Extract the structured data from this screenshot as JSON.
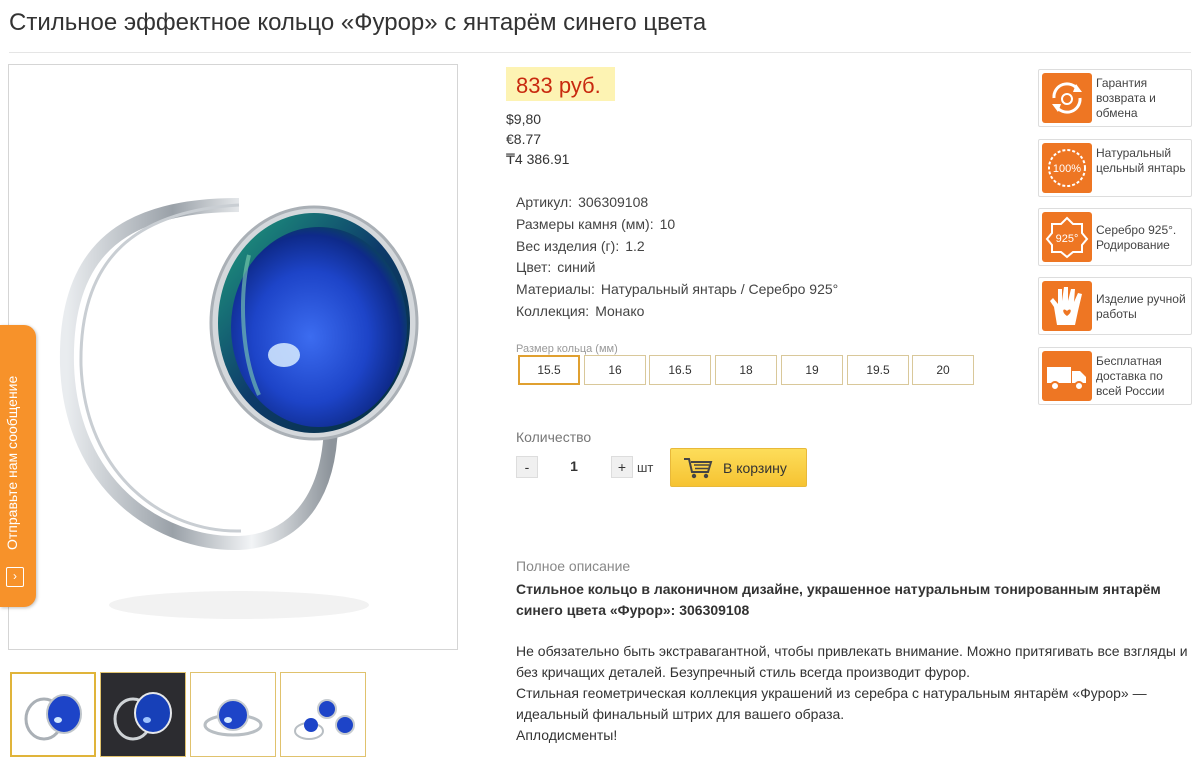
{
  "page": {
    "title": "Стильное эффектное кольцо «Фурор» с янтарём синего цвета"
  },
  "side_tab": {
    "label": "Отправьте нам сообщение"
  },
  "pricing": {
    "price": "833 руб.",
    "usd": "$9,80",
    "eur": "€8.77",
    "kzt": "₸4 386.91"
  },
  "specs": [
    {
      "label": "Артикул:",
      "value": "306309108"
    },
    {
      "label": "Размеры камня (мм):",
      "value": "10"
    },
    {
      "label": "Вес изделия (г):",
      "value": "1.2"
    },
    {
      "label": "Цвет:",
      "value": "синий"
    },
    {
      "label": "Материалы:",
      "value": "Натуральный янтарь / Серебро 925°"
    },
    {
      "label": "Коллекция:",
      "value": "Монако"
    }
  ],
  "ring_size": {
    "label": "Размер кольца (мм)",
    "selected": "15.5",
    "options": [
      "15.5",
      "16",
      "16.5",
      "18",
      "19",
      "19.5",
      "20"
    ]
  },
  "quantity": {
    "label": "Количество",
    "minus": "-",
    "plus": "+",
    "value": "1",
    "unit": "шт"
  },
  "cart": {
    "label": "В корзину"
  },
  "description": {
    "label": "Полное описание",
    "headline": "Стильное кольцо в лаконичном дизайне, украшенное натуральным тонированным янтарём синего цвета «Фурор»: 306309108",
    "paragraphs": [
      "Не обязательно быть экстравагантной, чтобы привлекать внимание. Можно притягивать все взгляды и без кричащих деталей. Безупречный стиль всегда производит фурор.",
      "Стильная геометрическая коллекция украшений из серебра с натуральным янтарём «Фурор» — идеальный финальный штрих для вашего образа.",
      "Аплодисменты!"
    ]
  },
  "features": [
    {
      "icon": "return-exchange-icon",
      "text": "Гарантия возврата и обмена"
    },
    {
      "icon": "natural-amber-100-icon",
      "icon_text": "100%",
      "text": "Натуральный цельный янтарь"
    },
    {
      "icon": "silver-925-icon",
      "icon_text": "925°",
      "text": "Серебро 925°. Родирование"
    },
    {
      "icon": "handmade-icon",
      "text": "Изделие ручной работы"
    },
    {
      "icon": "free-delivery-truck-icon",
      "text": "Бесплатная доставка по всей России"
    }
  ],
  "colors": {
    "price_red": "#c8290f",
    "price_bg": "#fdf3b3",
    "accent_orange": "#ee7623",
    "side_tab_orange": "#f7922a",
    "cart_yellow": "#f6c332",
    "stone_blue": "#1f4fd6"
  }
}
